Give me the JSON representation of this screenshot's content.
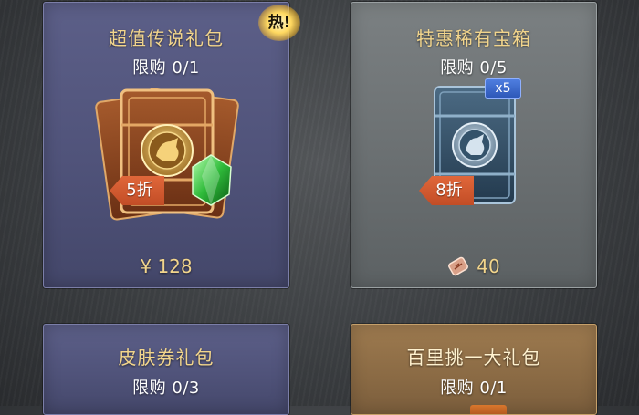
{
  "colors": {
    "title_gold": "#f2d58c",
    "discount_orange": "#d85a30",
    "card_purple": "#55587f",
    "card_steel": "#6f7476",
    "card_gold": "#8e6c45"
  },
  "shop": {
    "items": [
      {
        "title": "超值传说礼包",
        "limit": "限购 0/1",
        "discount": "5折",
        "badge": "热!",
        "price": "¥ 128",
        "art_icon": "legendary-card-bundle-icon"
      },
      {
        "title": "特惠稀有宝箱",
        "limit": "限购 0/5",
        "discount": "8折",
        "quantity_badge": "x5",
        "price": "40",
        "currency_icon": "ticket-coin-icon",
        "art_icon": "rare-card-pack-icon"
      },
      {
        "title": "皮肤券礼包",
        "limit": "限购 0/3"
      },
      {
        "title": "百里挑一大礼包",
        "limit": "限购 0/1"
      }
    ]
  }
}
